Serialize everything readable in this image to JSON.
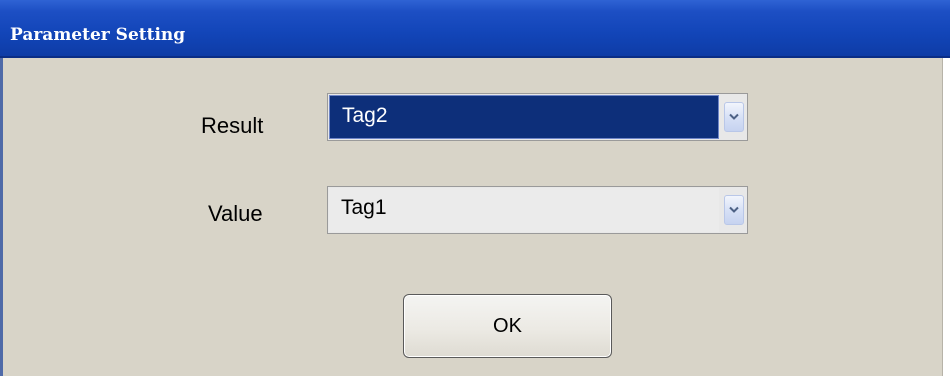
{
  "window": {
    "title": "Parameter Setting"
  },
  "form": {
    "result": {
      "label": "Result",
      "selected_value": "Tag2"
    },
    "value": {
      "label": "Value",
      "selected_value": "Tag1"
    }
  },
  "buttons": {
    "ok_label": "OK"
  },
  "icons": {
    "dropdown": "chevron-down-icon"
  },
  "colors": {
    "titlebar": "#1245b8",
    "dialog_background": "#d8d4c8",
    "selection_highlight": "#0d2f7a"
  }
}
